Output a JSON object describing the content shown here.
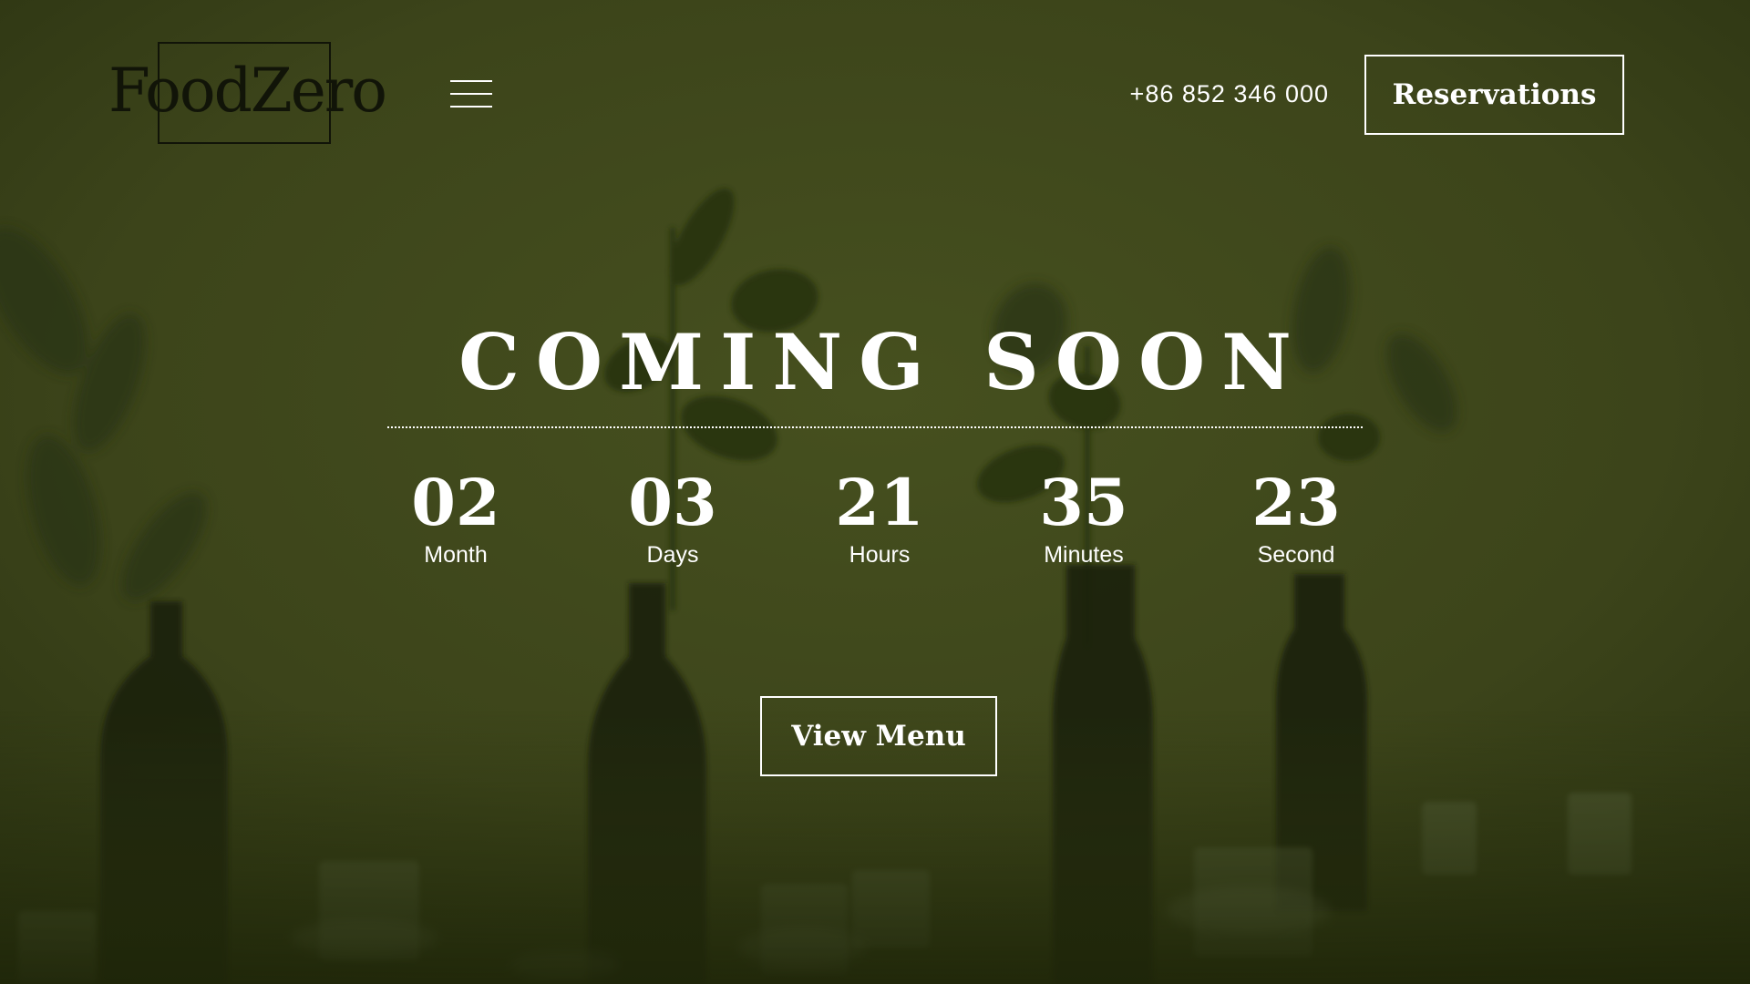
{
  "header": {
    "logo_text": "FoodZero",
    "phone": "+86 852 346 000",
    "reservations_label": "Reservations"
  },
  "hero": {
    "title": "COMING SOON",
    "countdown": [
      {
        "value": "02",
        "label": "Month"
      },
      {
        "value": "03",
        "label": "Days"
      },
      {
        "value": "21",
        "label": "Hours"
      },
      {
        "value": "35",
        "label": "Minutes"
      },
      {
        "value": "23",
        "label": "Second"
      }
    ],
    "view_menu_label": "View Menu"
  },
  "colors": {
    "overlay": "#3e451a",
    "logo_dark": "#111408",
    "text": "#ffffff"
  },
  "icons": {
    "menu": "hamburger-menu-icon"
  }
}
